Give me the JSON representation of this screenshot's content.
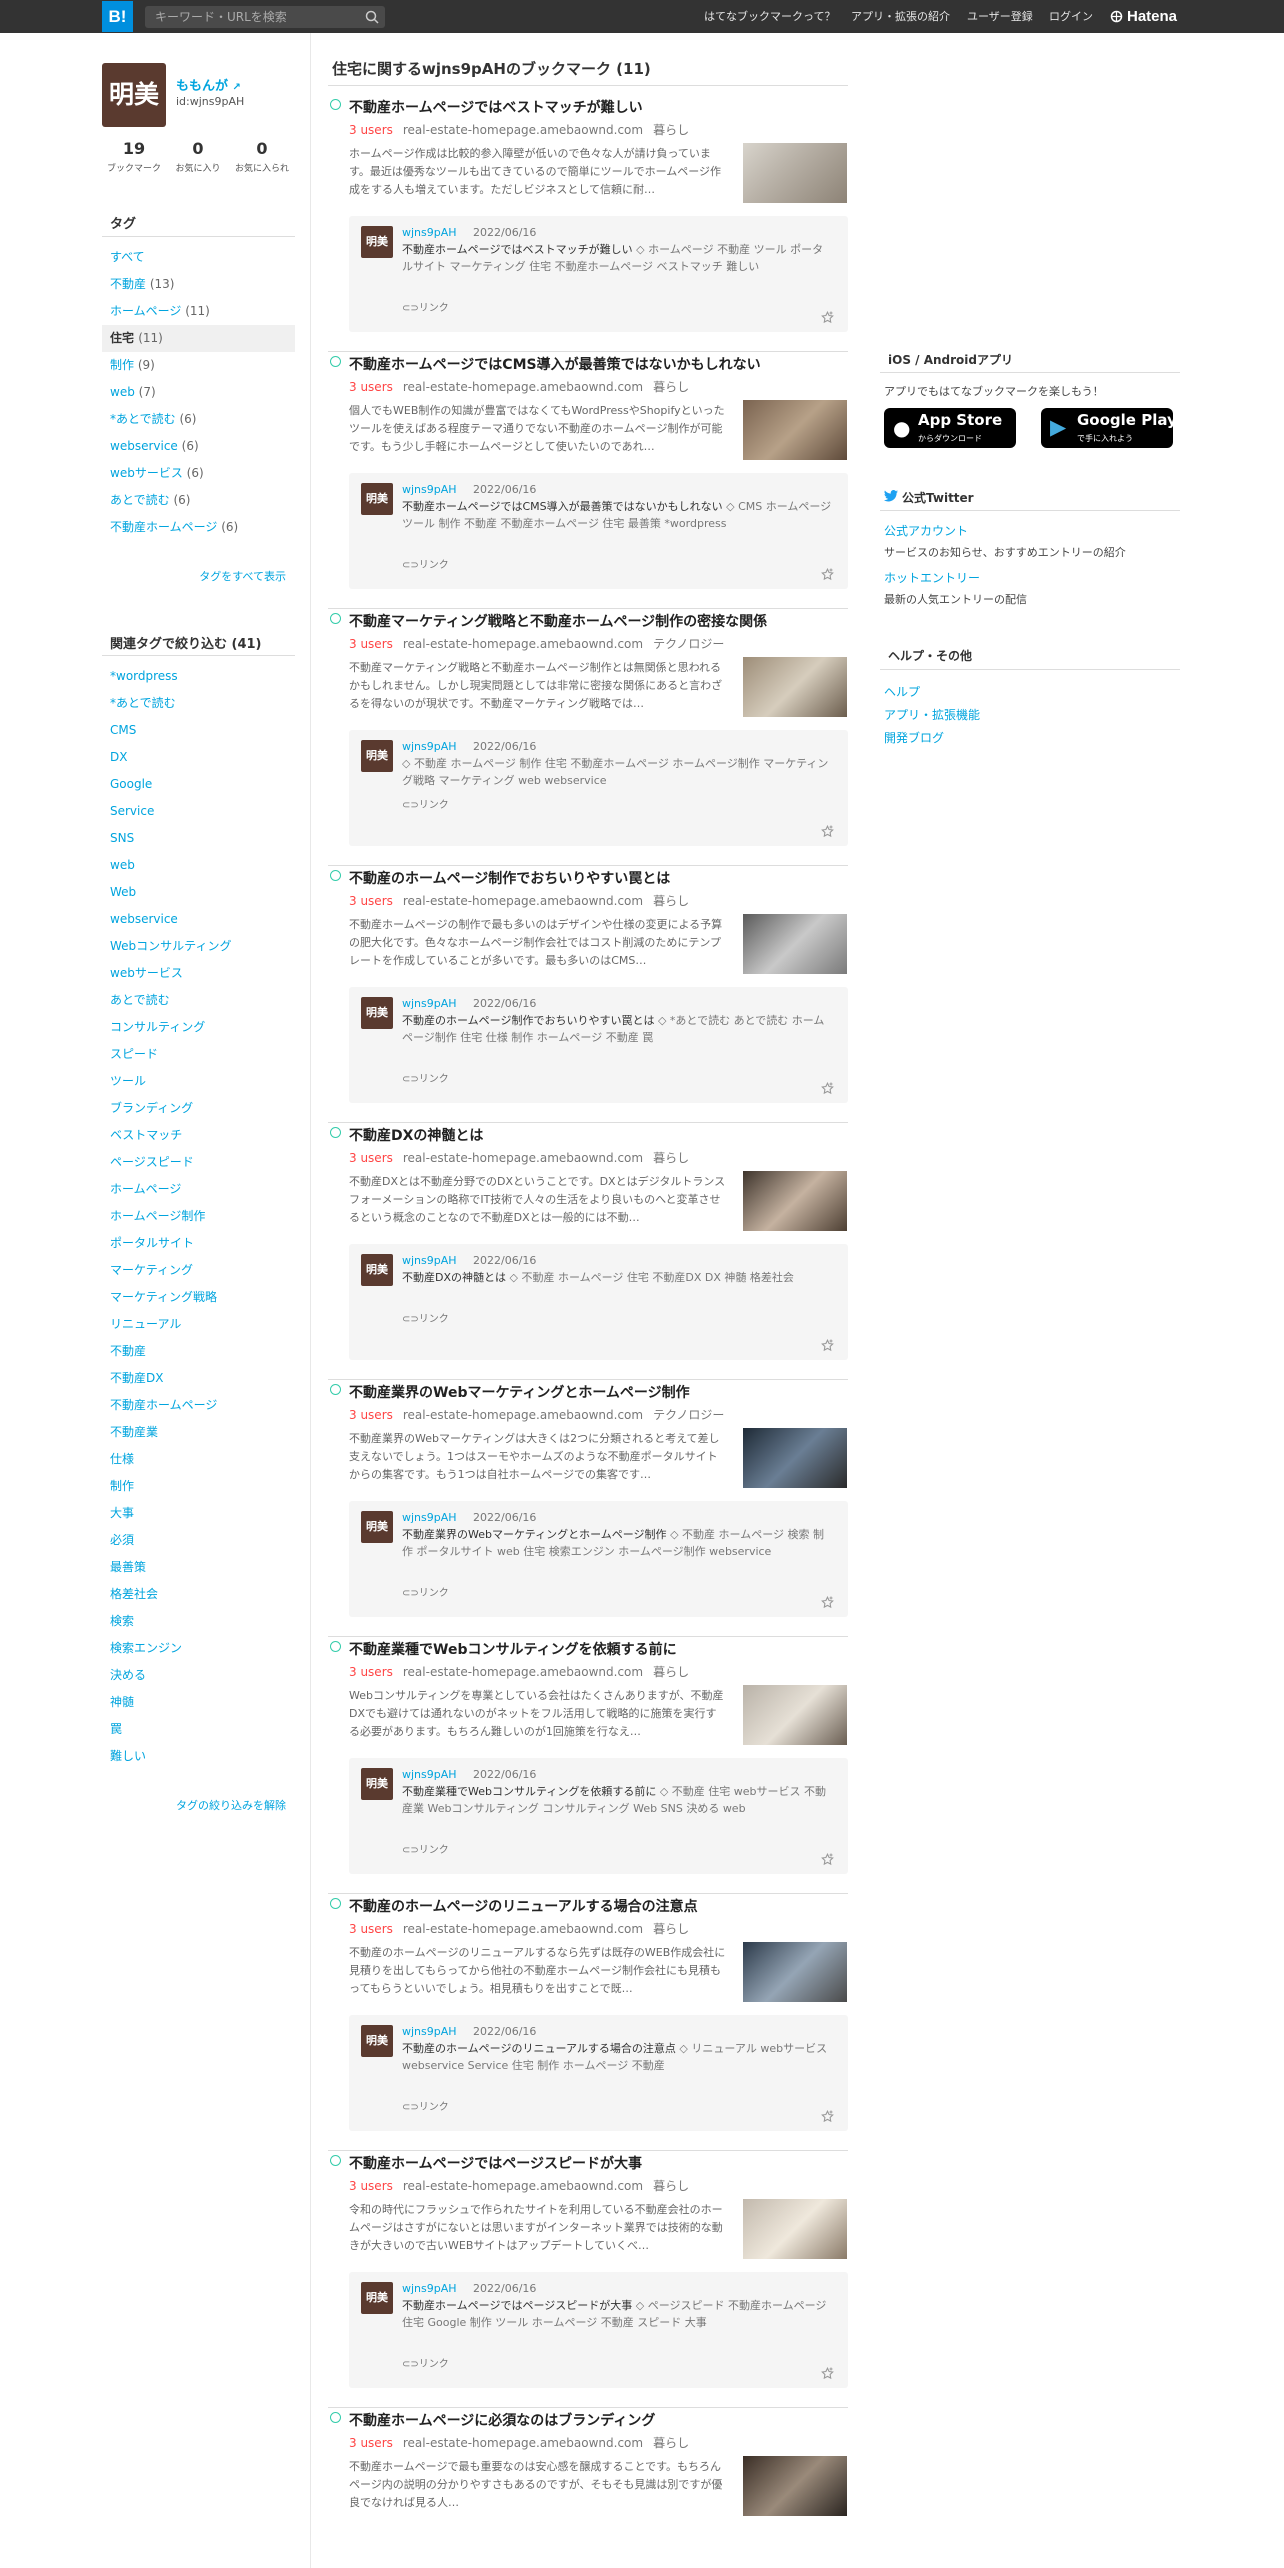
{
  "header": {
    "logo": "B!",
    "search_placeholder": "キーワード・URLを検索",
    "nav": [
      "はてなブックマークって？",
      "アプリ・拡張の紹介",
      "ユーザー登録",
      "ログイン"
    ],
    "hatena": "Hatena"
  },
  "profile": {
    "avatar_text": "明美",
    "name": "ももんが",
    "id": "id:wjns9pAH",
    "stats": [
      {
        "num": "19",
        "label": "ブックマーク"
      },
      {
        "num": "0",
        "label": "お気に入り"
      },
      {
        "num": "0",
        "label": "お気に入られ"
      }
    ]
  },
  "tags": {
    "heading": "タグ",
    "items": [
      {
        "label": "すべて",
        "count": ""
      },
      {
        "label": "不動産",
        "count": "(13)"
      },
      {
        "label": "ホームページ",
        "count": "(11)"
      },
      {
        "label": "住宅",
        "count": "(11)"
      },
      {
        "label": "制作",
        "count": "(9)"
      },
      {
        "label": "web",
        "count": "(7)"
      },
      {
        "label": "*あとで読む",
        "count": "(6)"
      },
      {
        "label": "webservice",
        "count": "(6)"
      },
      {
        "label": "webサービス",
        "count": "(6)"
      },
      {
        "label": "あとで読む",
        "count": "(6)"
      },
      {
        "label": "不動産ホームページ",
        "count": "(6)"
      }
    ],
    "show_all": "タグをすべて表示"
  },
  "related": {
    "heading": "関連タグで絞り込む (41)",
    "items": [
      "*wordpress",
      "*あとで読む",
      "CMS",
      "DX",
      "Google",
      "Service",
      "SNS",
      "web",
      "Web",
      "webservice",
      "Webコンサルティング",
      "webサービス",
      "あとで読む",
      "コンサルティング",
      "スピード",
      "ツール",
      "ブランディング",
      "ベストマッチ",
      "ページスピード",
      "ホームページ",
      "ホームページ制作",
      "ポータルサイト",
      "マーケティング",
      "マーケティング戦略",
      "リニューアル",
      "不動産",
      "不動産DX",
      "不動産ホームページ",
      "不動産業",
      "仕様",
      "制作",
      "大事",
      "必須",
      "最善策",
      "格差社会",
      "検索",
      "検索エンジン",
      "決める",
      "神髄",
      "罠",
      "難しい"
    ],
    "clear": "タグの絞り込みを解除"
  },
  "main": {
    "title": "住宅に関するwjns9pAHのブックマーク (11)"
  },
  "entries": [
    {
      "title": "不動産ホームページではベストマッチが難しい",
      "users": "3 users",
      "domain": "real-estate-homepage.amebaownd.com",
      "category": "暮らし",
      "desc": "ホームページ作成は比較的参入障壁が低いので色々な人が請け負っています。最近は優秀なツールも出てきているので簡単にツールでホームページ作成をする人も増えています。ただしビジネスとして信頼に耐…",
      "user": "wjns9pAH",
      "date": "2022/06/16",
      "bm_title": "不動産ホームページではベストマッチが難しい",
      "bm_tags": "ホームページ 不動産 ツール ポータルサイト マーケティング 住宅 不動産ホームページ ベストマッチ 難しい",
      "link": "リンク"
    },
    {
      "title": "不動産ホームページではCMS導入が最善策ではないかもしれない",
      "users": "3 users",
      "domain": "real-estate-homepage.amebaownd.com",
      "category": "暮らし",
      "desc": "個人でもWEB制作の知識が豊富ではなくてもWordPressやShopifyといったツールを使えばある程度テーマ通りでない不動産のホームページ制作が可能です。もう少し手軽にホームページとして使いたいのであれ…",
      "user": "wjns9pAH",
      "date": "2022/06/16",
      "bm_title": "不動産ホームページではCMS導入が最善策ではないかもしれない",
      "bm_tags": "CMS ホームページ ツール 制作 不動産 不動産ホームページ 住宅 最善策 *wordpress",
      "link": "リンク"
    },
    {
      "title": "不動産マーケティング戦略と不動産ホームページ制作の密接な関係",
      "users": "3 users",
      "domain": "real-estate-homepage.amebaownd.com",
      "category": "テクノロジー",
      "desc": "不動産マーケティング戦略と不動産ホームページ制作とは無関係と思われるかもしれません。しかし現実問題としては非常に密接な関係にあると言わざるを得ないのが現状です。不動産マーケティング戦略では…",
      "user": "wjns9pAH",
      "date": "2022/06/16",
      "bm_title": "",
      "bm_tags": "不動産 ホームページ 制作 住宅 不動産ホームページ ホームページ制作 マーケティング戦略 マーケティング web webservice",
      "link": "リンク"
    },
    {
      "title": "不動産のホームページ制作でおちいりやすい罠とは",
      "users": "3 users",
      "domain": "real-estate-homepage.amebaownd.com",
      "category": "暮らし",
      "desc": "不動産ホームページの制作で最も多いのはデザインや仕様の変更による予算の肥大化です。色々なホームページ制作会社ではコスト削減のためにテンプレートを作成していることが多いです。最も多いのはCMS…",
      "user": "wjns9pAH",
      "date": "2022/06/16",
      "bm_title": "不動産のホームページ制作でおちいりやすい罠とは",
      "bm_tags": "*あとで読む あとで読む ホームページ制作 住宅 仕様 制作 ホームページ 不動産 罠",
      "link": "リンク"
    },
    {
      "title": "不動産DXの神髄とは",
      "users": "3 users",
      "domain": "real-estate-homepage.amebaownd.com",
      "category": "暮らし",
      "desc": "不動産DXとは不動産分野でのDXということです。DXとはデジタルトランスフォーメーションの略称でIT技術で人々の生活をより良いものへと変革させるという概念のことなので不動産DXとは一般的には不動…",
      "user": "wjns9pAH",
      "date": "2022/06/16",
      "bm_title": "不動産DXの神髄とは",
      "bm_tags": "不動産 ホームページ 住宅 不動産DX DX 神髄 格差社会",
      "link": "リンク"
    },
    {
      "title": "不動産業界のWebマーケティングとホームページ制作",
      "users": "3 users",
      "domain": "real-estate-homepage.amebaownd.com",
      "category": "テクノロジー",
      "desc": "不動産業界のWebマーケティングは大きくは2つに分類されると考えて差し支えないでしょう。1つはスーモやホームズのような不動産ポータルサイトからの集客です。もう1つは自社ホームページでの集客です…",
      "user": "wjns9pAH",
      "date": "2022/06/16",
      "bm_title": "不動産業界のWebマーケティングとホームページ制作",
      "bm_tags": "不動産 ホームページ 検索 制作 ポータルサイト web 住宅 検索エンジン ホームページ制作 webservice",
      "link": "リンク"
    },
    {
      "title": "不動産業種でWebコンサルティングを依頼する前に",
      "users": "3 users",
      "domain": "real-estate-homepage.amebaownd.com",
      "category": "暮らし",
      "desc": "Webコンサルティングを専業としている会社はたくさんありますが、不動産DXでも避けては通れないのがネットをフル活用して戦略的に施策を実行する必要があります。もちろん難しいのが1回施策を行なえ…",
      "user": "wjns9pAH",
      "date": "2022/06/16",
      "bm_title": "不動産業種でWebコンサルティングを依頼する前に",
      "bm_tags": "不動産 住宅 webサービス 不動産業 Webコンサルティング コンサルティング Web SNS 決める web",
      "link": "リンク"
    },
    {
      "title": "不動産のホームページのリニューアルする場合の注意点",
      "users": "3 users",
      "domain": "real-estate-homepage.amebaownd.com",
      "category": "暮らし",
      "desc": "不動産のホームページのリニューアルするなら先ずは既存のWEB作成会社に見積りを出してもらってから他社の不動産ホームページ制作会社にも見積もってもらうといいでしょう。相見積もりを出すことで既…",
      "user": "wjns9pAH",
      "date": "2022/06/16",
      "bm_title": "不動産のホームページのリニューアルする場合の注意点",
      "bm_tags": "リニューアル webサービス webservice Service 住宅 制作 ホームページ 不動産",
      "link": "リンク"
    },
    {
      "title": "不動産ホームページではページスピードが大事",
      "users": "3 users",
      "domain": "real-estate-homepage.amebaownd.com",
      "category": "暮らし",
      "desc": "令和の時代にフラッシュで作られたサイトを利用している不動産会社のホームページはさすがにないとは思いますがインターネット業界では技術的な動きが大きいので古いWEBサイトはアップデートしていくべ…",
      "user": "wjns9pAH",
      "date": "2022/06/16",
      "bm_title": "不動産ホームページではページスピードが大事",
      "bm_tags": "ページスピード 不動産ホームページ 住宅 Google 制作 ツール ホームページ 不動産 スピード 大事",
      "link": "リンク"
    },
    {
      "title": "不動産ホームページに必須なのはブランディング",
      "users": "3 users",
      "domain": "real-estate-homepage.amebaownd.com",
      "category": "暮らし",
      "desc": "不動産ホームページで最も重要なのは安心感を醸成することです。もちろんページ内の説明の分かりやすさもあるのですが、そもそも見識は別ですが優良でなければ見る人…",
      "user": "",
      "date": "",
      "bm_title": "",
      "bm_tags": "",
      "link": ""
    }
  ],
  "right": {
    "app_heading": "iOS / Androidアプリ",
    "app_text": "アプリでもはてなブックマークを楽しもう！",
    "appstore": {
      "sub": "からダウンロード",
      "main": "App Store"
    },
    "googleplay": {
      "sub": "で手に入れよう",
      "main": "Google Play"
    },
    "twitter_heading": "公式Twitter",
    "account_link": "公式アカウント",
    "account_desc": "サービスのお知らせ、おすすめエントリーの紹介",
    "hot_link": "ホットエントリー",
    "hot_desc": "最新の人気エントリーの配信",
    "help_heading": "ヘルプ・その他",
    "help_links": [
      "ヘルプ",
      "アプリ・拡張機能",
      "開発ブログ"
    ]
  },
  "colors": {
    "accent": "#00a4de",
    "users": "#ff4444",
    "topbar": "#333333",
    "avatar": "#5a3a2f"
  }
}
